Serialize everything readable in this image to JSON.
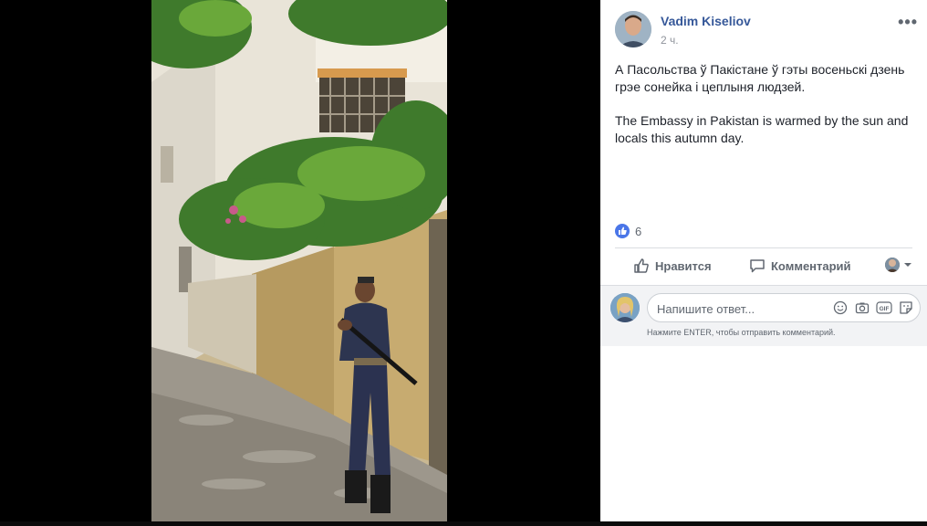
{
  "post": {
    "author": "Vadim Kiseliov",
    "time": "2 ч.",
    "more_icon": "•••",
    "text_by": "А Пасольства ў Пакістане ў гэты восеньскі дзень грэе сонейка і цеплыня людзей.",
    "text_en": "The Embassy in Pakistan is warmed by the sun and locals this autumn day."
  },
  "reactions": {
    "count": "6",
    "icon": "thumbs-up"
  },
  "actions": {
    "like_label": "Нравится",
    "comment_label": "Комментарий"
  },
  "comment_box": {
    "placeholder": "Напишите ответ...",
    "hint": "Нажмите ENTER, чтобы отправить комментарий."
  },
  "colors": {
    "link": "#365899",
    "like_badge": "#4a76e8",
    "panel_bg": "#ffffff",
    "comment_bg": "#f2f3f5"
  }
}
